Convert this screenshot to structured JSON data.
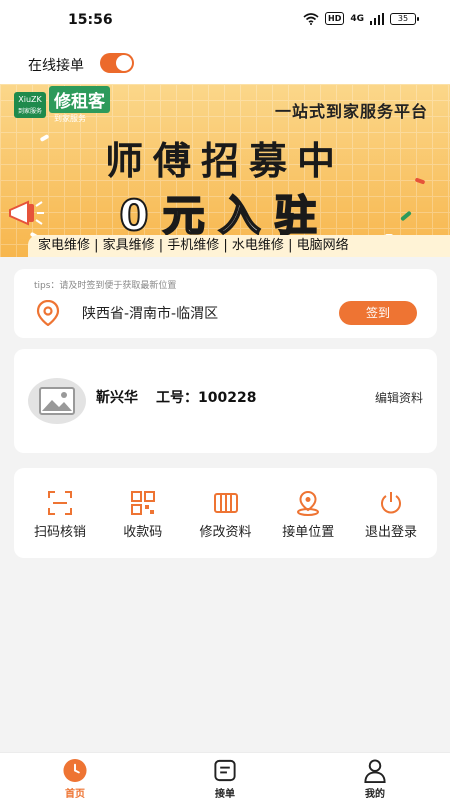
{
  "status_bar": {
    "time": "15:56",
    "hd": "HD",
    "signal": "4G",
    "battery": "35"
  },
  "online": {
    "label": "在线接单",
    "toggle_on": true
  },
  "banner": {
    "logo_badge": "XiuZK",
    "logo_sub": "到家服务",
    "logo_name": "修租客",
    "logo_tag": "到家服务",
    "slogan": "一站式到家服务平台",
    "headline": "师傅招募中",
    "subline": "0元入驻",
    "services": "家电维修 | 家具维修 | 手机维修 | 水电维修 | 电脑网络"
  },
  "location": {
    "tips": "tips：请及时签到便于获取最新位置",
    "address": "陕西省-渭南市-临渭区",
    "checkin_label": "签到"
  },
  "profile": {
    "name": "靳兴华",
    "job_no": "工号：100228",
    "edit_label": "编辑资料"
  },
  "actions": [
    {
      "label": "扫码核销",
      "icon": "scan-icon"
    },
    {
      "label": "收款码",
      "icon": "qrcode-icon"
    },
    {
      "label": "修改资料",
      "icon": "edit-info-icon"
    },
    {
      "label": "接单位置",
      "icon": "location-icon"
    },
    {
      "label": "退出登录",
      "icon": "power-icon"
    }
  ],
  "tabbar": [
    {
      "label": "首页",
      "icon": "home-icon",
      "active": true
    },
    {
      "label": "接单",
      "icon": "orders-icon",
      "active": false
    },
    {
      "label": "我的",
      "icon": "user-icon",
      "active": false
    }
  ],
  "colors": {
    "accent": "#ee7433",
    "banner_top": "#fbd78a",
    "banner_bottom": "#f7b64d",
    "icon": "#ee7433"
  }
}
